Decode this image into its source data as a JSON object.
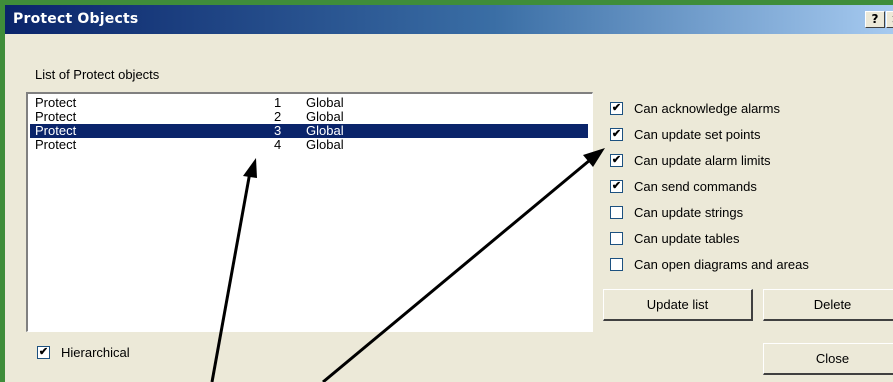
{
  "window": {
    "title": "Protect Objects",
    "help_glyph": "?",
    "close_glyph": "×"
  },
  "list": {
    "label": "List of Protect objects",
    "rows": [
      {
        "name": "Protect",
        "number": "1",
        "scope": "Global",
        "selected": false
      },
      {
        "name": "Protect",
        "number": "2",
        "scope": "Global",
        "selected": false
      },
      {
        "name": "Protect",
        "number": "3",
        "scope": "Global",
        "selected": true
      },
      {
        "name": "Protect",
        "number": "4",
        "scope": "Global",
        "selected": false
      }
    ]
  },
  "permissions": [
    {
      "label": "Can acknowledge alarms",
      "checked": true
    },
    {
      "label": "Can update set points",
      "checked": true
    },
    {
      "label": "Can update alarm limits",
      "checked": true
    },
    {
      "label": "Can send commands",
      "checked": true
    },
    {
      "label": "Can update strings",
      "checked": false
    },
    {
      "label": "Can update tables",
      "checked": false
    },
    {
      "label": "Can open diagrams and areas",
      "checked": false
    }
  ],
  "buttons": {
    "update_list": "Update list",
    "delete": "Delete",
    "close": "Close"
  },
  "hierarchical": {
    "label": "Hierarchical",
    "checked": true
  },
  "check_glyph": "✔",
  "colors": {
    "selection": "#0a246a",
    "dialog_bg": "#ece9d8",
    "annotation_arrow": "#000000"
  }
}
